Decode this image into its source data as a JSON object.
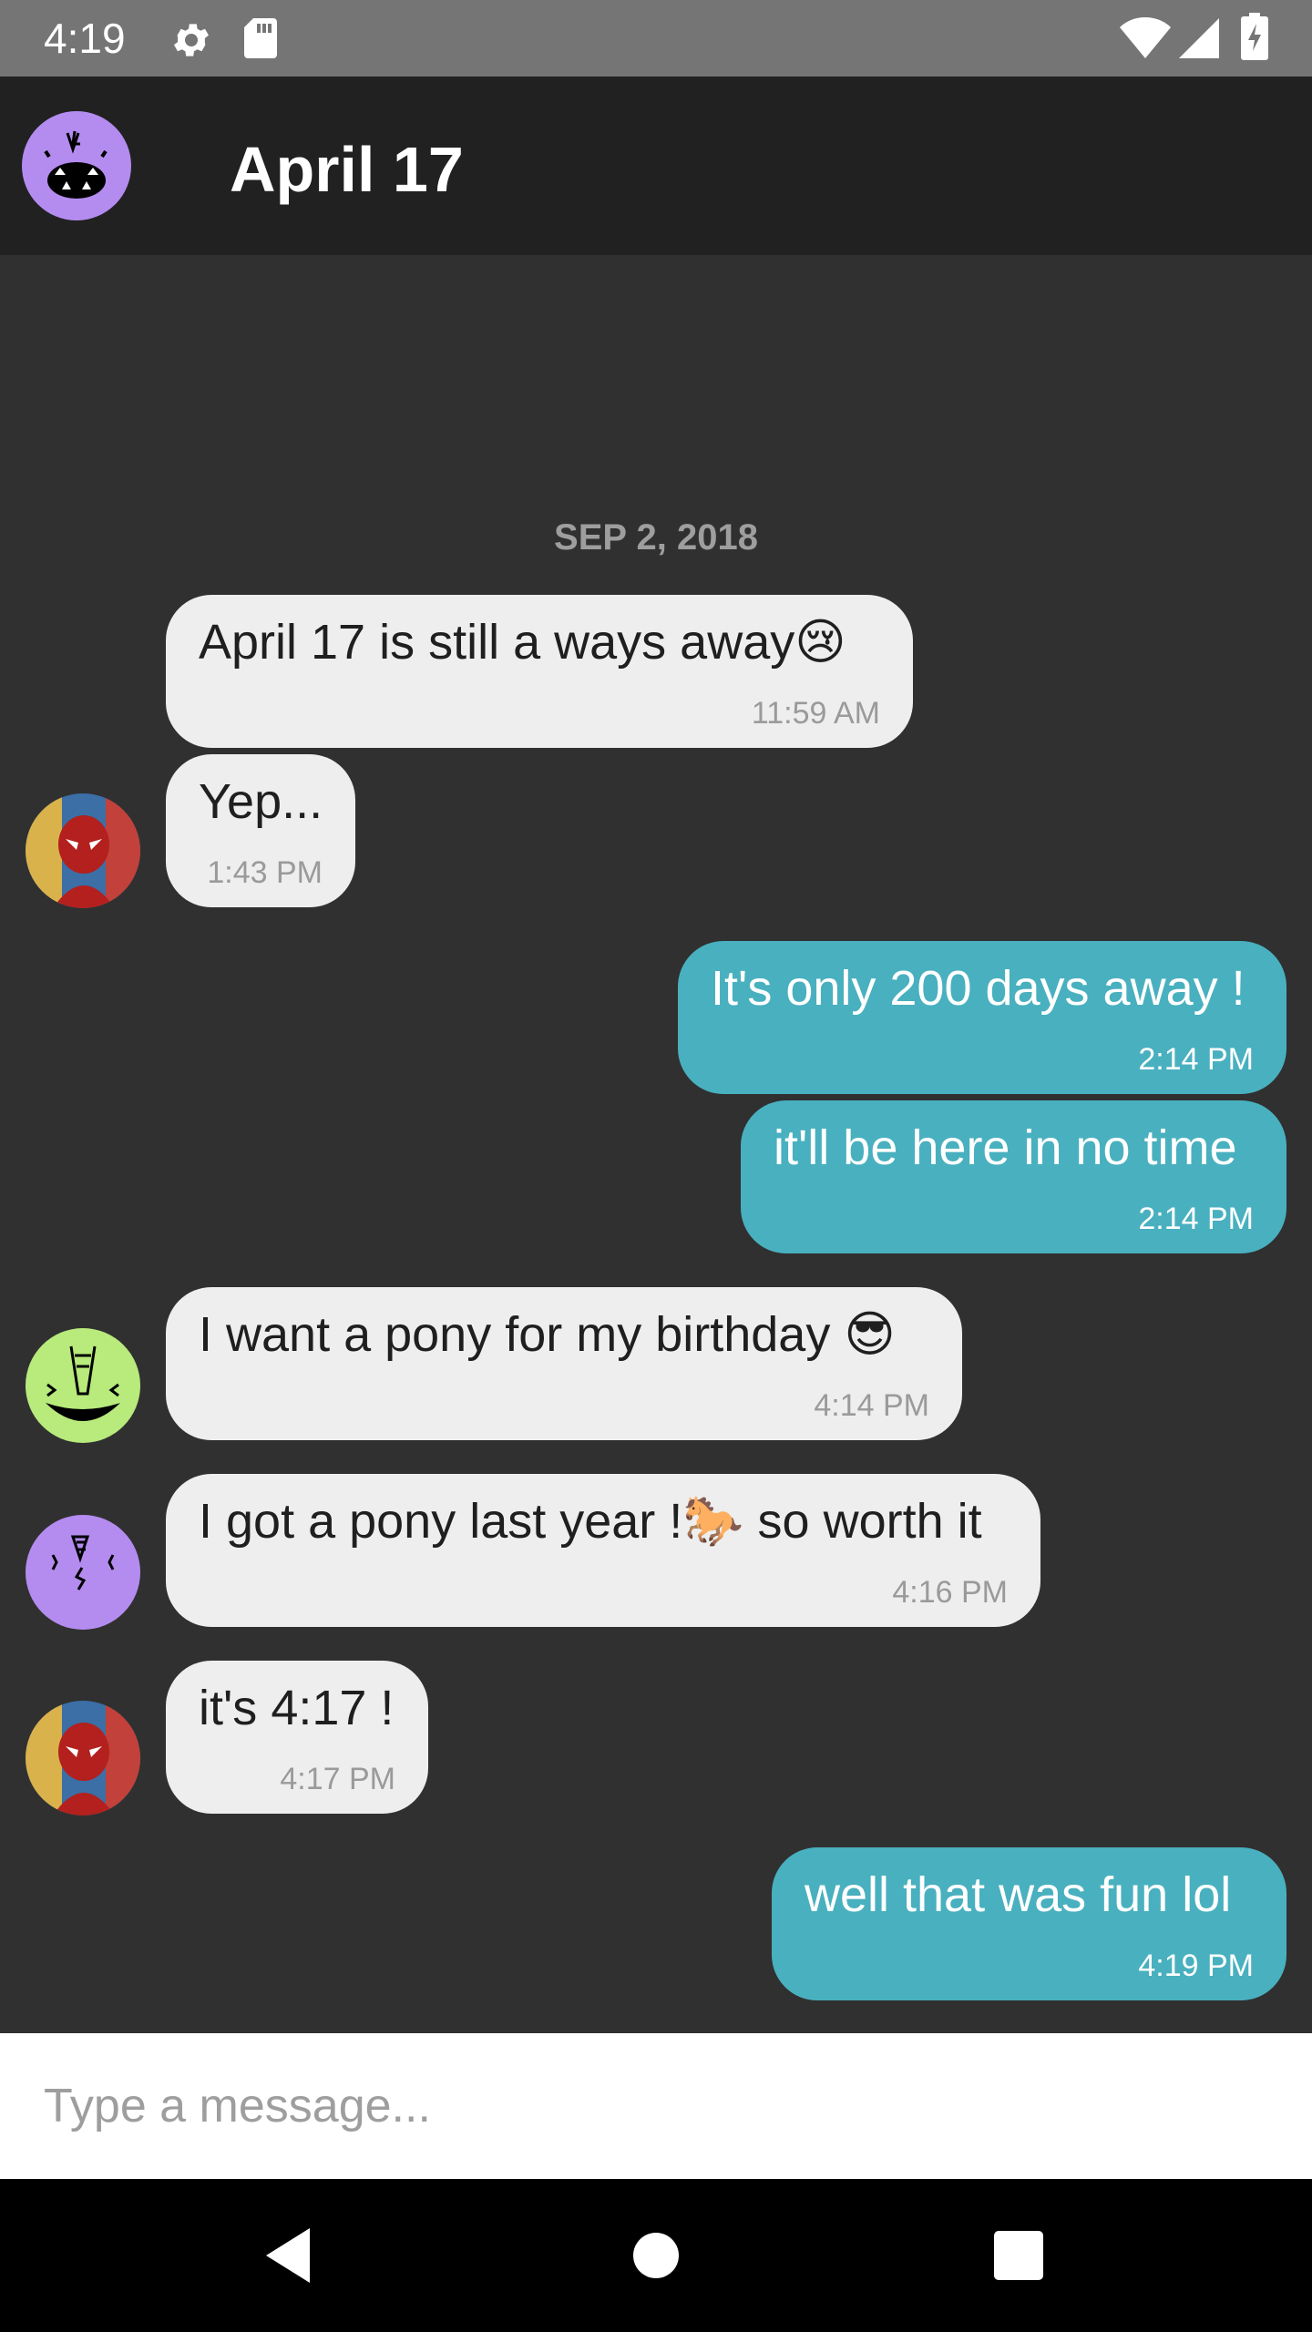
{
  "status_bar": {
    "time": "4:19",
    "icons": [
      "gear-icon",
      "sd-card-icon",
      "wifi-icon",
      "signal-icon",
      "battery-charging-icon"
    ]
  },
  "app_bar": {
    "title": "April 17",
    "avatar_icon": "monster-face-avatar"
  },
  "conversation": {
    "date_divider": "SEP 2, 2018",
    "messages": [
      {
        "direction": "incoming",
        "text": "April 17 is still a ways away😢",
        "time": "11:59 AM",
        "avatar": "none"
      },
      {
        "direction": "incoming",
        "text": "Yep...",
        "time": "1:43 PM",
        "avatar": "spiderman-avatar"
      },
      {
        "direction": "outgoing",
        "text": "It's only 200 days away !",
        "time": "2:14 PM"
      },
      {
        "direction": "outgoing",
        "text": "it'll be here in no time",
        "time": "2:14 PM"
      },
      {
        "direction": "incoming",
        "text": "I want a pony for my birthday 😎",
        "time": "4:14 PM",
        "avatar": "green-monster-avatar"
      },
      {
        "direction": "incoming",
        "text": "I got a pony last year !🐎 so worth it",
        "time": "4:16 PM",
        "avatar": "purple-monster-avatar"
      },
      {
        "direction": "incoming",
        "text": "it's 4:17 !",
        "time": "4:17 PM",
        "avatar": "spiderman-avatar"
      },
      {
        "direction": "outgoing",
        "text": "well that was fun lol",
        "time": "4:19 PM"
      }
    ]
  },
  "composer": {
    "placeholder": "Type a message..."
  },
  "nav_bar": {
    "buttons": [
      "back-icon",
      "home-icon",
      "recents-icon"
    ]
  },
  "colors": {
    "background": "#303030",
    "app_bar": "#212121",
    "status_bar": "#757575",
    "incoming_bubble": "#eeeeee",
    "outgoing_bubble": "#49b0bf"
  }
}
